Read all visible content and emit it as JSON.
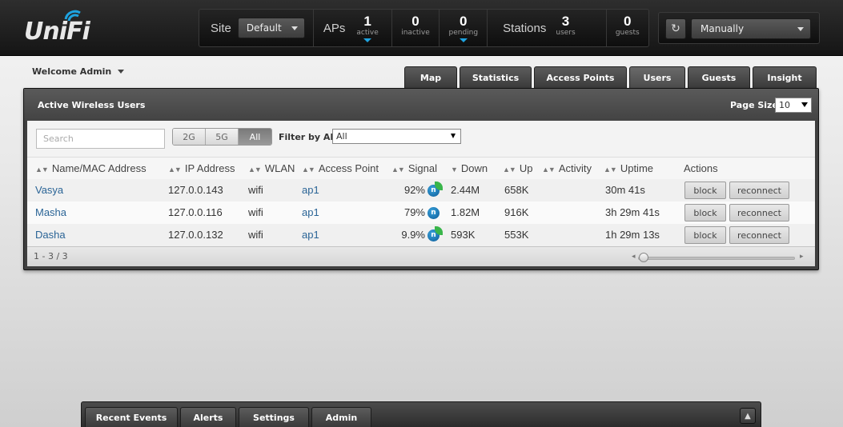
{
  "logo": {
    "text": "UniFi"
  },
  "header": {
    "site_label": "Site",
    "site_value": "Default",
    "aps_label": "APs",
    "aps_active": {
      "num": "1",
      "sub": "active"
    },
    "aps_inactive": {
      "num": "0",
      "sub": "inactive"
    },
    "aps_pending": {
      "num": "0",
      "sub": "pending"
    },
    "stations_label": "Stations",
    "stations_users": {
      "num": "3",
      "sub": "users"
    },
    "stations_guests": {
      "num": "0",
      "sub": "guests"
    },
    "refresh_icon": "refresh-icon",
    "mode_value": "Manually"
  },
  "welcome": "Welcome Admin",
  "tabs": [
    {
      "label": "Map"
    },
    {
      "label": "Statistics"
    },
    {
      "label": "Access Points"
    },
    {
      "label": "Users"
    },
    {
      "label": "Guests"
    },
    {
      "label": "Insight"
    }
  ],
  "panel": {
    "title": "Active Wireless Users",
    "page_size_label": "Page Size",
    "page_size_value": "10",
    "search_placeholder": "Search",
    "bands": [
      "2G",
      "5G",
      "All"
    ],
    "filter_label": "Filter by AP",
    "filter_value": "All",
    "columns": [
      "Name/MAC Address",
      "IP Address",
      "WLAN",
      "Access Point",
      "Signal",
      "Down",
      "Up",
      "Activity",
      "Uptime",
      "Actions"
    ],
    "rows": [
      {
        "name": "Vasya",
        "ip": "127.0.0.143",
        "wlan": "wifi",
        "ap": "ap1",
        "signal": "92%",
        "radio": "n",
        "down": "2.44M",
        "up": "658K",
        "activity": "",
        "uptime": "30m 41s",
        "block": "block",
        "reconnect": "reconnect"
      },
      {
        "name": "Masha",
        "ip": "127.0.0.116",
        "wlan": "wifi",
        "ap": "ap1",
        "signal": "79%",
        "radio": "n",
        "down": "1.82M",
        "up": "916K",
        "activity": "",
        "uptime": "3h 29m 41s",
        "block": "block",
        "reconnect": "reconnect"
      },
      {
        "name": "Dasha",
        "ip": "127.0.0.132",
        "wlan": "wifi",
        "ap": "ap1",
        "signal": "9.9%",
        "radio": "n",
        "down": "593K",
        "up": "553K",
        "activity": "",
        "uptime": "1h 29m 13s",
        "block": "block",
        "reconnect": "reconnect"
      }
    ],
    "paging": "1 - 3 / 3"
  },
  "bottom_tabs": [
    {
      "label": "Recent Events"
    },
    {
      "label": "Alerts"
    },
    {
      "label": "Settings"
    },
    {
      "label": "Admin"
    }
  ],
  "colors": {
    "accent": "#1ea3e0",
    "link": "#2a6496",
    "radio": "#0b5a97",
    "leaf": "#39b54a"
  }
}
